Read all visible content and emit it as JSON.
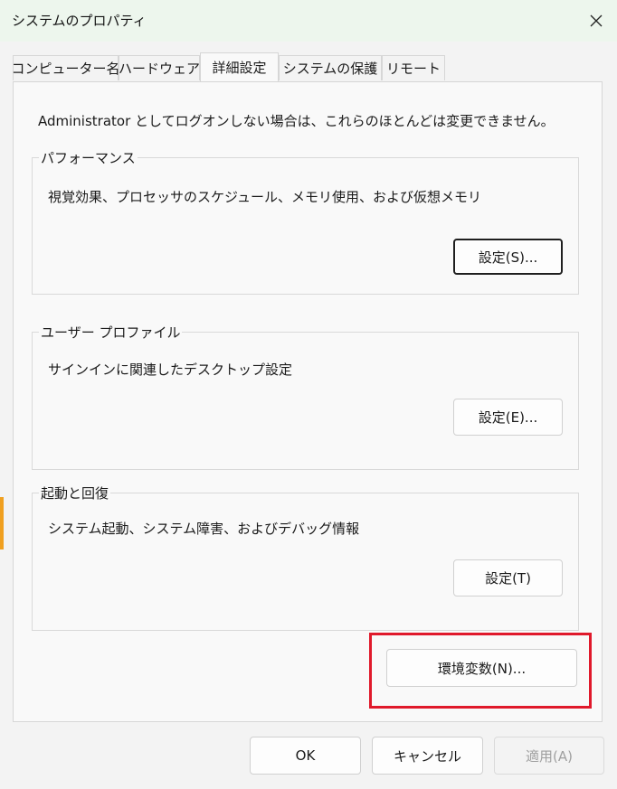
{
  "window": {
    "title": "システムのプロパティ",
    "close_icon": "close-icon"
  },
  "tabs": [
    {
      "label": "コンピューター名"
    },
    {
      "label": "ハードウェア"
    },
    {
      "label": "詳細設定",
      "active": true
    },
    {
      "label": "システムの保護"
    },
    {
      "label": "リモート"
    }
  ],
  "notice": "Administrator としてログオンしない場合は、これらのほとんどは変更できません。",
  "groups": {
    "performance": {
      "title": "パフォーマンス",
      "description": "視覚効果、プロセッサのスケジュール、メモリ使用、および仮想メモリ",
      "button": "設定(S)..."
    },
    "user_profile": {
      "title": "ユーザー プロファイル",
      "description": "サインインに関連したデスクトップ設定",
      "button": "設定(E)..."
    },
    "startup": {
      "title": "起動と回復",
      "description": "システム起動、システム障害、およびデバッグ情報",
      "button": "設定(T)"
    }
  },
  "env_button": "環境変数(N)...",
  "footer": {
    "ok": "OK",
    "cancel": "キャンセル",
    "apply": "適用(A)"
  },
  "colors": {
    "highlight": "#e0192b",
    "titlebar": "#edf6ed"
  }
}
